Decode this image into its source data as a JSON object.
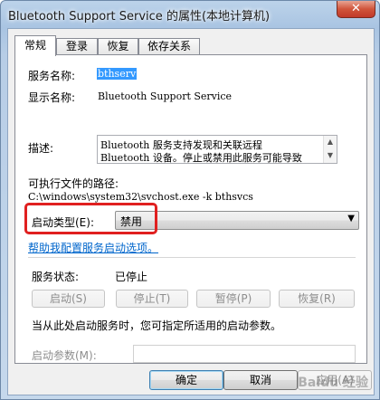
{
  "window": {
    "title": "Bluetooth Support Service 的属性(本地计算机)",
    "close_glyph": "✕"
  },
  "tabs": [
    {
      "label": "常规",
      "active": true
    },
    {
      "label": "登录",
      "active": false
    },
    {
      "label": "恢复",
      "active": false
    },
    {
      "label": "依存关系",
      "active": false
    }
  ],
  "general": {
    "service_name_label": "服务名称:",
    "service_name_value": "bthserv",
    "display_name_label": "显示名称:",
    "display_name_value": "Bluetooth Support Service",
    "description_label": "描述:",
    "description_lines": [
      "Bluetooth 服务支持发现和关联远程",
      "Bluetooth 设备。停止或禁用此服务可能导致"
    ],
    "exe_path_label": "可执行文件的路径:",
    "exe_path_value": "C:\\windows\\system32\\svchost.exe -k bthsvcs",
    "startup_type_label": "启动类型(E):",
    "startup_type_value": "禁用",
    "help_link": "帮助我配置服务启动选项。",
    "status_label": "服务状态:",
    "status_value": "已停止",
    "buttons": {
      "start": "启动(S)",
      "stop": "停止(T)",
      "pause": "暂停(P)",
      "resume": "恢复(R)"
    },
    "hint_text": "当从此处启动服务时，您可指定所适用的启动参数。",
    "start_params_label": "启动参数(M):",
    "start_params_value": ""
  },
  "dialog_buttons": {
    "ok": "确定",
    "cancel": "取消",
    "apply": "应用(A)"
  },
  "watermark": "Baidu 经验",
  "icons": {
    "combo_arrow": "▼",
    "scroll_up": "▲",
    "scroll_down": "▼"
  },
  "colors": {
    "highlight_rect": "#e02020",
    "link": "#0066cc",
    "selection": "#3399ff"
  }
}
